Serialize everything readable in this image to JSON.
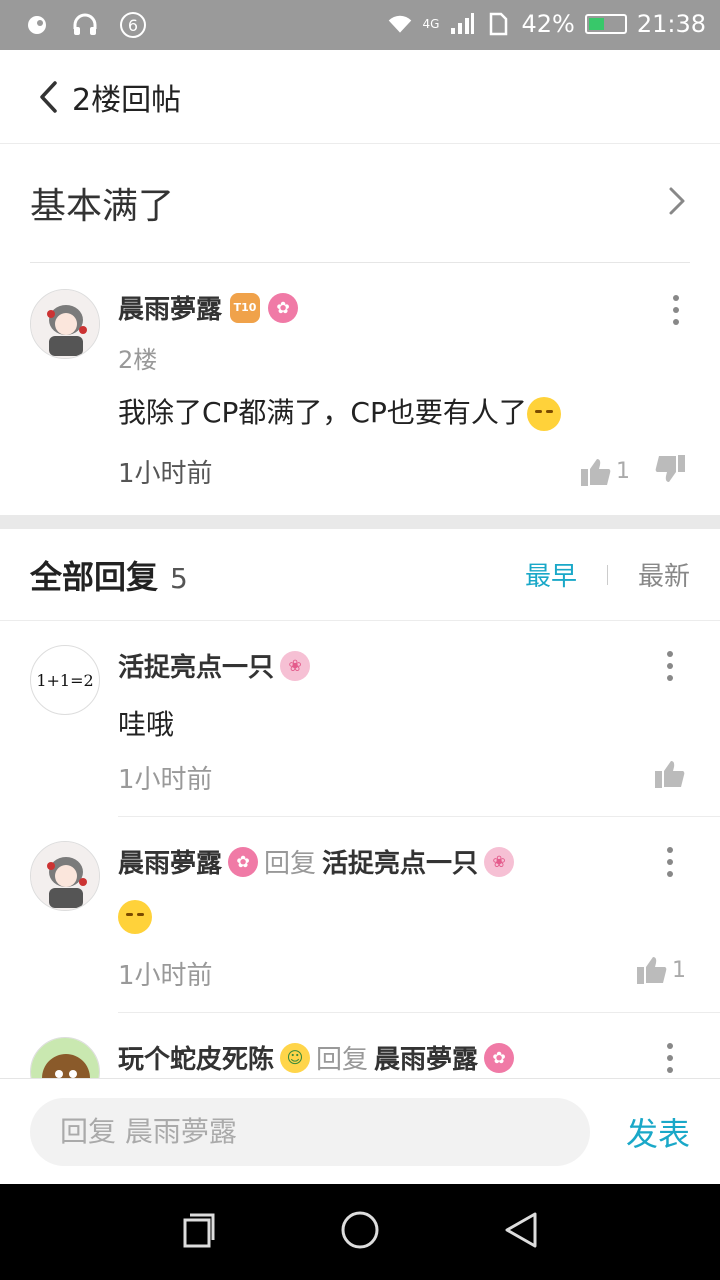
{
  "status_bar": {
    "notification_count": "6",
    "network": "4G",
    "battery": "42%",
    "time": "21:38"
  },
  "header": {
    "title": "2楼回帖"
  },
  "thread": {
    "title": "基本满了"
  },
  "post": {
    "author": "晨雨夢露",
    "badge_level": "T10",
    "floor": "2楼",
    "content": "我除了CP都满了，CP也要有人了",
    "time": "1小时前",
    "like_count": "1"
  },
  "replies": {
    "title": "全部回复",
    "count": "5",
    "sort_earliest": "最早",
    "sort_latest": "最新",
    "items": [
      {
        "author": "活捉亮点一只",
        "reply_word": "",
        "reply_to": "",
        "content": "哇哦",
        "time": "1小时前",
        "like_count": "",
        "avatar_text": "1+1=2"
      },
      {
        "author": "晨雨夢露",
        "reply_word": "回复",
        "reply_to": "活捉亮点一只",
        "content": "",
        "time": "1小时前",
        "like_count": "1"
      },
      {
        "author": "玩个蛇皮死陈",
        "reply_word": "回复",
        "reply_to": "晨雨夢露",
        "content": "",
        "time": "",
        "like_count": ""
      }
    ]
  },
  "composer": {
    "placeholder": "回复 晨雨夢露",
    "send_label": "发表"
  },
  "colors": {
    "accent": "#1aa8c8",
    "badge_pink": "#f07aa6",
    "status_bar": "#9a9a9a"
  }
}
